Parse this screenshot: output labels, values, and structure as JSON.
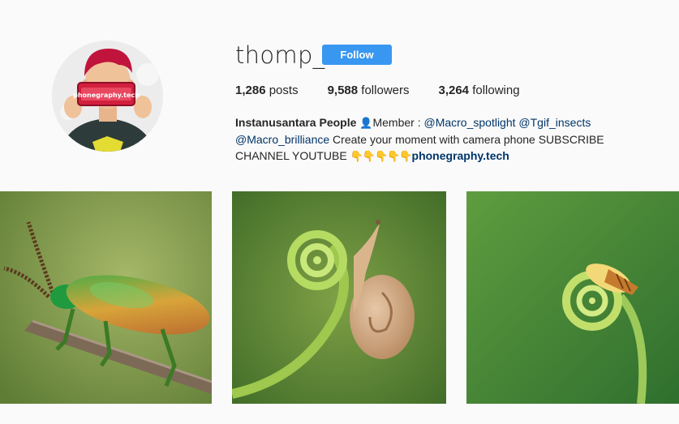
{
  "profile": {
    "username": "thomp_",
    "follow_label": "Follow",
    "avatar_screen_text": "phonegraphy.tech"
  },
  "stats": {
    "posts_count": "1,286",
    "posts_label": "posts",
    "followers_count": "9,588",
    "followers_label": "followers",
    "following_count": "3,264",
    "following_label": "following"
  },
  "bio": {
    "name": "Instanusantara People",
    "member_text": "Member : ",
    "mention1": "@Macro_spotlight",
    "mention2": "@Tgif_insects",
    "mention3": "@Macro_brilliance",
    "text": " Create your moment with camera phone SUBSCRIBE CHANNEL YOUTUBE ",
    "website": "phonegraphy.tech",
    "person_emoji": "👤",
    "pointing_emoji": "👇👇👇👇👇"
  },
  "posts": [
    {
      "subject": "green-metallic-beetle-on-branch"
    },
    {
      "subject": "snail-on-fern-fiddlehead"
    },
    {
      "subject": "small-snail-on-fern-curl"
    }
  ],
  "colors": {
    "follow_button": "#3897f0",
    "link": "#003569",
    "text": "#262626",
    "background": "#fafafa"
  }
}
